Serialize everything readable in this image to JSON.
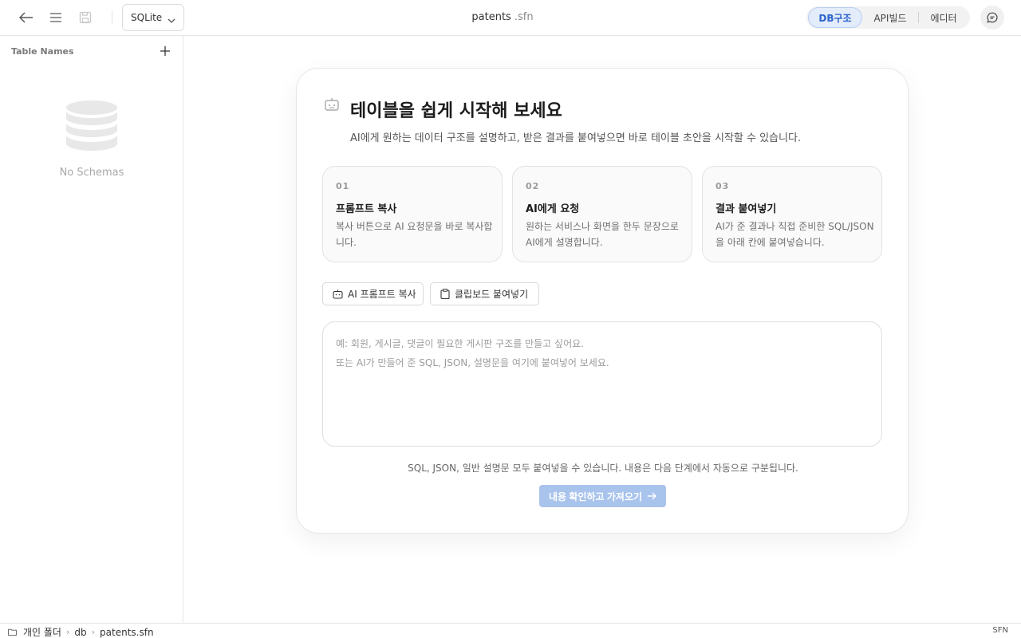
{
  "header": {
    "db_type": "SQLite",
    "file_name": "patents",
    "file_ext": ".sfn",
    "tabs": [
      {
        "label": "DB구조",
        "active": true
      },
      {
        "label": "API빌드",
        "active": false
      },
      {
        "label": "에디터",
        "active": false
      }
    ],
    "icons": [
      "back-arrow-icon",
      "menu-icon",
      "save-icon",
      "chevron-down-icon",
      "chat-icon"
    ]
  },
  "sidebar": {
    "title": "Table Names",
    "empty_text": "No Schemas"
  },
  "main": {
    "title": "테이블을 쉽게 시작해 보세요",
    "subtitle": "AI에게 원하는 데이터 구조를 설명하고, 받은 결과를 붙여넣으면 바로 테이블 초안을 시작할 수 있습니다.",
    "steps": [
      {
        "num": "01",
        "title": "프롬프트 복사",
        "desc": "복사 버튼으로 AI 요청문을 바로 복사합니다."
      },
      {
        "num": "02",
        "title": "AI에게 요청",
        "desc": "원하는 서비스나 화면을 한두 문장으로 AI에게 설명합니다."
      },
      {
        "num": "03",
        "title": "결과 붙여넣기",
        "desc": "AI가 준 결과나 직접 준비한 SQL/JSON을 아래 칸에 붙여넣습니다."
      }
    ],
    "copy_prompt_label": "AI 프롬프트 복사",
    "paste_clipboard_label": "클립보드 붙여넣기",
    "input_placeholder": "예: 회원, 게시글, 댓글이 필요한 게시판 구조를 만들고 싶어요.\n또는 AI가 만들어 준 SQL, JSON, 설명문을 여기에 붙여넣어 보세요.",
    "input_value": "",
    "hint": "SQL, JSON, 일반 설명문 모두 붙여넣을 수 있습니다. 내용은 다음 단계에서 자동으로 구분됩니다.",
    "confirm_label": "내용 확인하고 가져오기",
    "confirm_enabled": false,
    "accent_color": "#2b63c9",
    "confirm_color_disabled": "#a9c4ec"
  },
  "statusbar": {
    "breadcrumb": [
      "개인 폴더",
      "db",
      "patents.sfn"
    ],
    "right_label": "SFN"
  }
}
